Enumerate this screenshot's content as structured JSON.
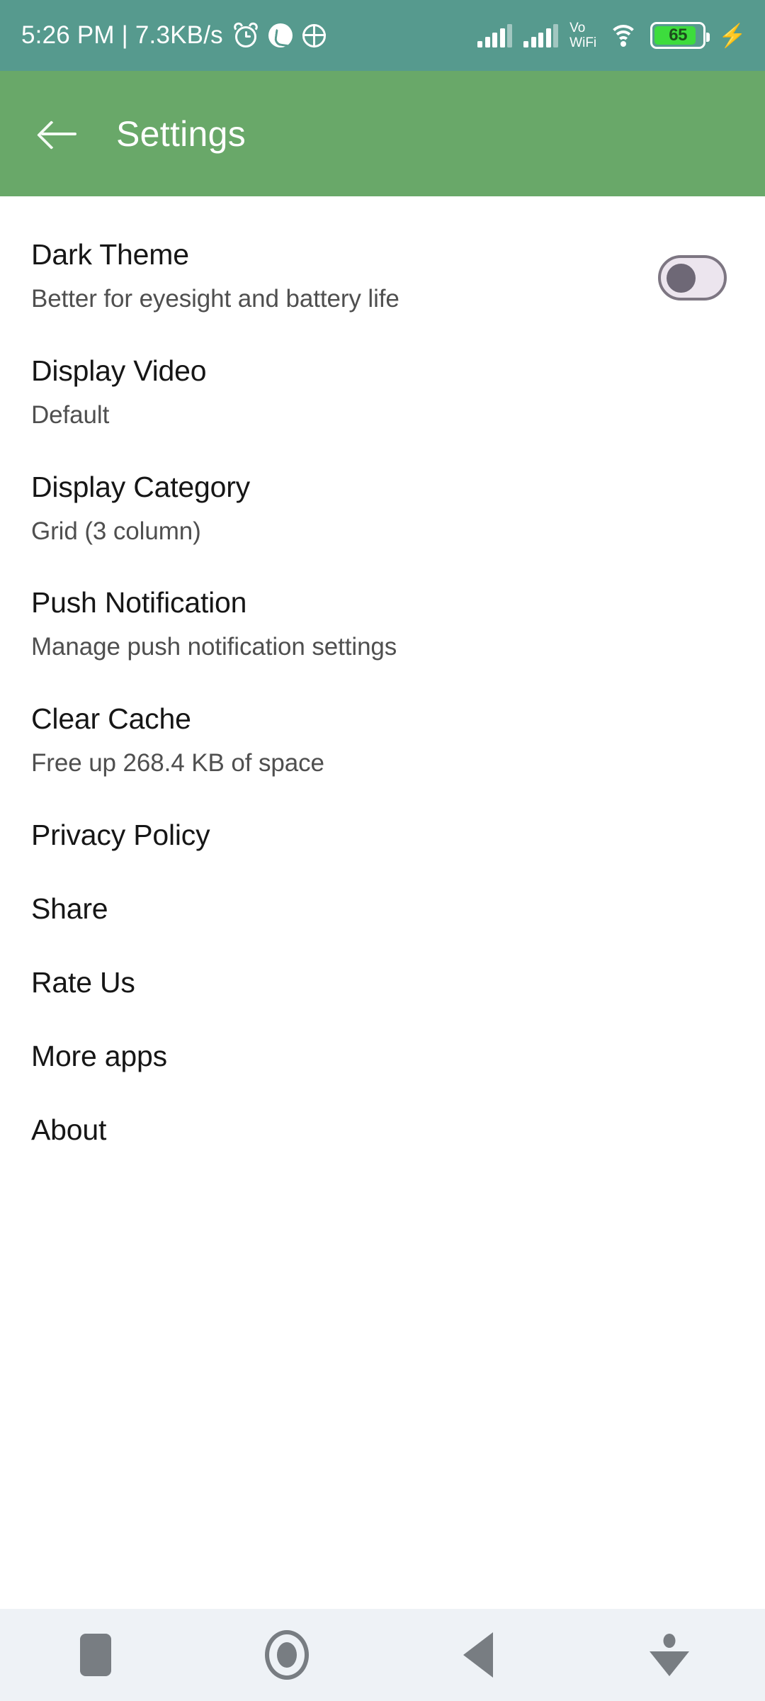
{
  "status_bar": {
    "clock": "5:26 PM | 7.3KB/s",
    "icons_left": [
      "alarm-icon",
      "phone-icon",
      "hotspot-icon"
    ],
    "network_label": "Vo WiFi",
    "network_label_line1": "Vo",
    "network_label_line2": "WiFi",
    "icons_right": [
      "signal-icon",
      "signal-icon",
      "wifi-icon",
      "battery-icon",
      "charging-bolt-icon"
    ],
    "battery_level": "65",
    "charging_glyph": "⚡",
    "background_color": "#569a8e"
  },
  "app_bar": {
    "title": "Settings",
    "back_label": "back-arrow",
    "background_color": "#69a869"
  },
  "settings": {
    "items": [
      {
        "title": "Dark Theme",
        "subtitle": "Better for eyesight and battery life",
        "control": "toggle",
        "toggle_on": false
      },
      {
        "title": "Display Video",
        "subtitle": "Default",
        "control": "none"
      },
      {
        "title": "Display Category",
        "subtitle": "Grid (3 column)",
        "control": "none"
      },
      {
        "title": "Push Notification",
        "subtitle": "Manage push notification settings",
        "control": "none"
      },
      {
        "title": "Clear Cache",
        "subtitle": "Free up 268.4 KB of space",
        "control": "none"
      },
      {
        "title": "Privacy Policy",
        "subtitle": "",
        "control": "none"
      },
      {
        "title": "Share",
        "subtitle": "",
        "control": "none"
      },
      {
        "title": "Rate Us",
        "subtitle": "",
        "control": "none"
      },
      {
        "title": "More apps",
        "subtitle": "",
        "control": "none"
      },
      {
        "title": "About",
        "subtitle": "",
        "control": "none"
      }
    ]
  },
  "nav_bar": {
    "buttons": [
      "recents-icon",
      "home-icon",
      "back-icon",
      "hide-keyboard-icon"
    ],
    "background_color": "#eef2f6"
  }
}
